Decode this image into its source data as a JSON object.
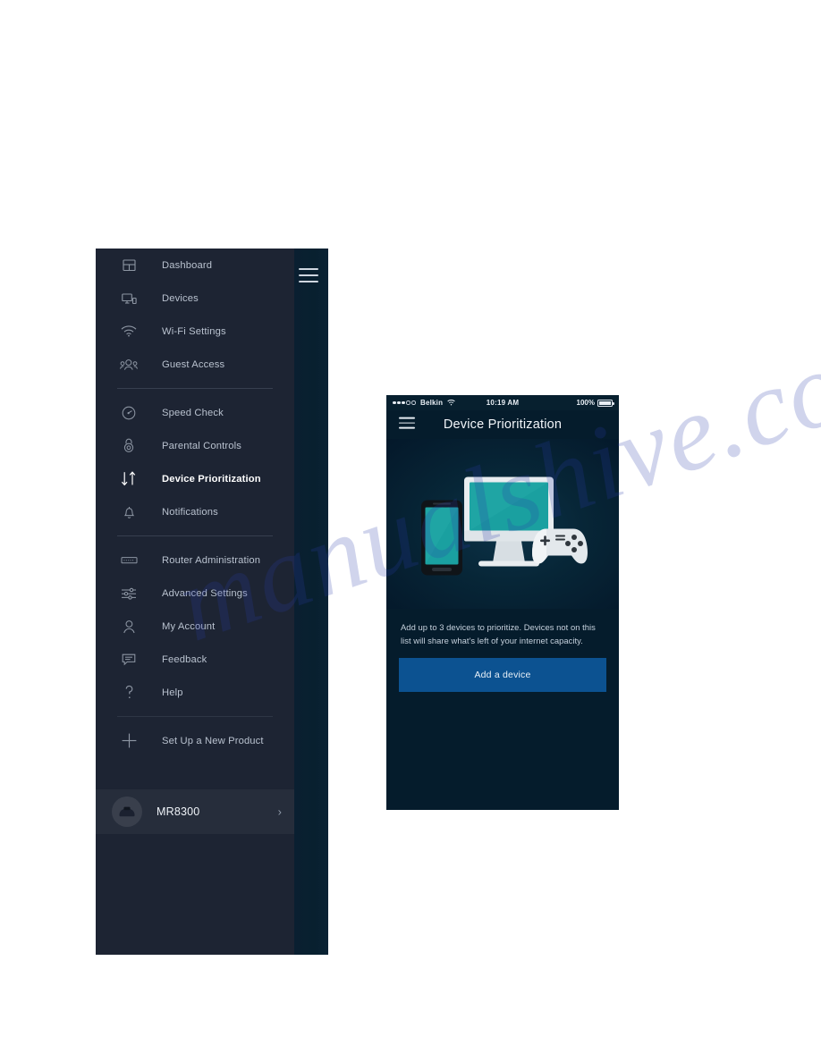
{
  "sidebar": {
    "hamburger_icon": "hamburger-menu-icon",
    "groups": [
      {
        "items": [
          {
            "label": "Dashboard",
            "icon": "dashboard-grid-icon",
            "active": false
          },
          {
            "label": "Devices",
            "icon": "devices-icon",
            "active": false
          },
          {
            "label": "Wi-Fi Settings",
            "icon": "wifi-icon",
            "active": false
          },
          {
            "label": "Guest Access",
            "icon": "guest-people-icon",
            "active": false
          }
        ]
      },
      {
        "items": [
          {
            "label": "Speed Check",
            "icon": "speedometer-icon",
            "active": false
          },
          {
            "label": "Parental Controls",
            "icon": "lock-icon",
            "active": false
          },
          {
            "label": "Device Prioritization",
            "icon": "up-down-arrows-icon",
            "active": true
          },
          {
            "label": "Notifications",
            "icon": "bell-icon",
            "active": false
          }
        ]
      },
      {
        "items": [
          {
            "label": "Router Administration",
            "icon": "router-icon",
            "active": false
          },
          {
            "label": "Advanced Settings",
            "icon": "sliders-icon",
            "active": false
          },
          {
            "label": "My Account",
            "icon": "person-icon",
            "active": false
          },
          {
            "label": "Feedback",
            "icon": "chat-bubble-icon",
            "active": false
          },
          {
            "label": "Help",
            "icon": "question-mark-icon",
            "active": false
          }
        ]
      },
      {
        "items": [
          {
            "label": "Set Up a New Product",
            "icon": "plus-icon",
            "active": false
          }
        ]
      }
    ],
    "router_row": {
      "name": "MR8300",
      "avatar_icon": "router-device-icon",
      "chevron_icon": "chevron-right-icon"
    }
  },
  "phone": {
    "status_bar": {
      "signal_icon": "signal-dots-icon",
      "signal_filled": 3,
      "signal_empty": 2,
      "carrier": "Belkin",
      "wifi_icon": "wifi-icon",
      "time": "10:19 AM",
      "battery_label": "100%",
      "battery_icon": "battery-full-icon"
    },
    "header": {
      "menu_icon": "hamburger-menu-icon",
      "title": "Device Prioritization"
    },
    "hero": {
      "illustration": "devices-illustration-phone-monitor-gamepad"
    },
    "description": "Add up to 3 devices to prioritize. Devices not on this list will share what's left of your internet capacity.",
    "primary_button": {
      "label": "Add a device"
    }
  },
  "watermark": {
    "text": "manualshive.com"
  },
  "colors": {
    "sidebar_bg": "#1d2433",
    "sidebar_edge": "#0a2234",
    "phone_bg": "#051c2c",
    "button_blue": "#0c5291",
    "screen_teal": "#1aa0a0",
    "label_text": "#b9c2cf",
    "active_text": "#ffffff"
  }
}
